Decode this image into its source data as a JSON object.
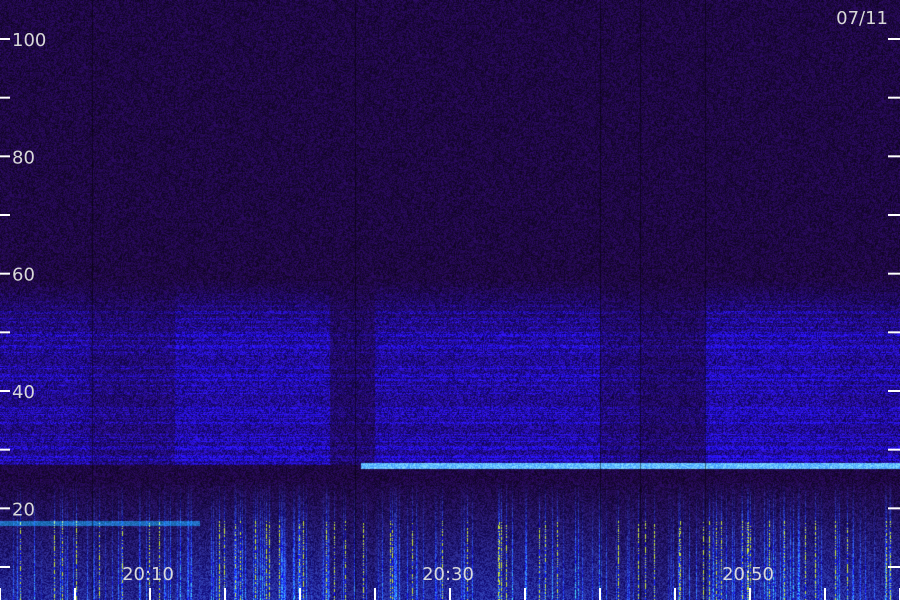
{
  "chart_data": {
    "type": "heatmap",
    "date_label": "07/11",
    "y_ticks": [
      {
        "value": 100,
        "label": "100"
      },
      {
        "value": 80,
        "label": "80"
      },
      {
        "value": 60,
        "label": "60"
      },
      {
        "value": 40,
        "label": "40"
      },
      {
        "value": 20,
        "label": "20"
      }
    ],
    "y_minor_ticks": [
      10,
      30,
      50,
      70,
      90
    ],
    "y_range": [
      10,
      108
    ],
    "x_ticks": [
      {
        "value": "20:10",
        "label": "20:10"
      },
      {
        "value": "20:30",
        "label": "20:30"
      },
      {
        "value": "20:50",
        "label": "20:50"
      }
    ],
    "colors": {
      "background": "#2a0b55",
      "mid_band": "#3014d0",
      "low_band": "#1a7cff",
      "line": "#5ec8ff",
      "hot": "#dfe832"
    }
  }
}
